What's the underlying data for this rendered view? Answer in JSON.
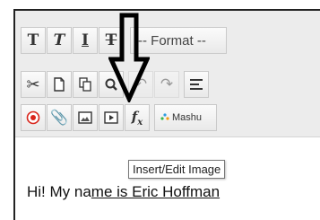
{
  "toolbar": {
    "row1": {
      "bold_label": "T",
      "italic_label": "T",
      "underline_label": "I",
      "strike_label": "T",
      "format_label": "-- Format --"
    },
    "row2": {},
    "row3": {
      "plugin_label": "Mashu"
    }
  },
  "tooltip": {
    "text": "Insert/Edit Image"
  },
  "editor": {
    "text_before": "Hi! My na",
    "text_underlined": "me is Eric Hoffman"
  },
  "colors": {
    "toolbar_bg": "#ececec",
    "button_border": "#c9c9c9",
    "record_red": "#d9261c",
    "annotation_arrow": "#000000"
  },
  "icons": [
    "scissors-icon",
    "document-icon",
    "copy-icon",
    "search-icon",
    "undo-icon",
    "redo-icon",
    "align-left-icon",
    "record-icon",
    "paperclip-icon",
    "image-icon",
    "media-icon",
    "fx-icon",
    "plugin-icon",
    "down-arrow-icon"
  ]
}
